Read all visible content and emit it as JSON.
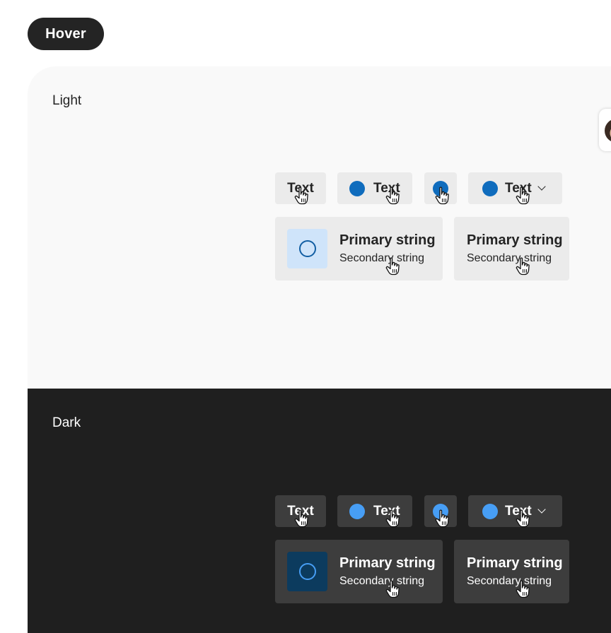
{
  "state_label": "Hover",
  "light": {
    "title": "Light",
    "buttons": {
      "text_only": "Text",
      "icon_text": "Text",
      "menu": "Text"
    },
    "card_with_icon": {
      "primary": "Primary string",
      "secondary": "Secondary string"
    },
    "card_plain": {
      "primary": "Primary string",
      "secondary": "Secondary string"
    }
  },
  "dark": {
    "title": "Dark",
    "buttons": {
      "text_only": "Text",
      "icon_text": "Text",
      "menu": "Text"
    },
    "card_with_icon": {
      "primary": "Primary string",
      "secondary": "Secondary string"
    },
    "card_plain": {
      "primary": "Primary string",
      "secondary": "Secondary string"
    }
  },
  "colors": {
    "light_accent": "#0f6cbd",
    "dark_accent": "#479ef5",
    "light_hover_bg": "#ebebeb",
    "dark_hover_bg": "#3d3d3d"
  },
  "icons": [
    "circle-icon",
    "ring-icon",
    "chevron-down-icon",
    "hand-cursor-icon"
  ]
}
